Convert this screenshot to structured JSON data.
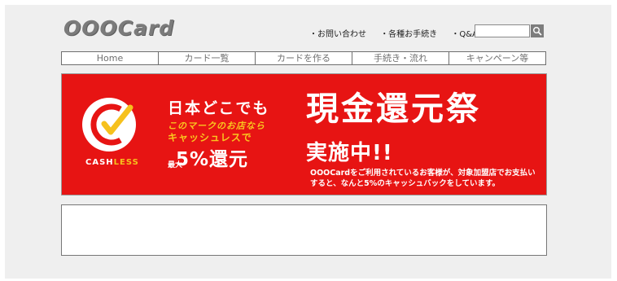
{
  "header": {
    "logo": "OOOCard",
    "links": [
      "・お問い合わせ",
      "・各種お手続き",
      "・Q&A"
    ],
    "search": {
      "value": "",
      "placeholder": ""
    }
  },
  "nav": {
    "items": [
      "Home",
      "カード一覧",
      "カードを作る",
      "手続き・流れ",
      "キャンペーン等"
    ]
  },
  "banner": {
    "cashless_mark": {
      "cash": "CASH",
      "less": "LESS"
    },
    "line1": "日本どこでも",
    "line2": "このマークのお店なら",
    "line3": "キャッシュレスで",
    "line4_small": "最大",
    "line4_big": "5%還元",
    "title": "現金還元祭",
    "subtitle": "実施中!!",
    "description": "OOOCardをご利用されているお客様が、対象加盟店でお支払いすると、なんと5%のキャッシュバックをしています。"
  },
  "colors": {
    "banner_red": "#e71413",
    "accent_yellow": "#f6c11d",
    "logo_gray": "#7b7b7b"
  },
  "icons": {
    "search_button": "search-icon"
  }
}
